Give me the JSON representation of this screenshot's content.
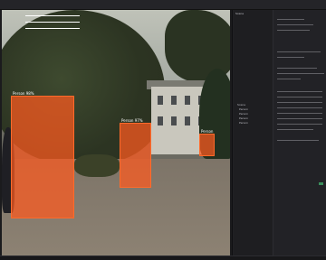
{
  "viewer": {
    "detections": [
      {
        "label": "Person 98%"
      },
      {
        "label": "Person 97%"
      },
      {
        "label": "Person"
      }
    ]
  },
  "sidebar": {
    "panel_title": "Scene",
    "tree_items": [
      "Scene",
      "Person",
      "Person",
      "Person",
      "Person"
    ]
  },
  "colors": {
    "highlight": "#ff6a2a",
    "accent": "#3a8f5c"
  }
}
